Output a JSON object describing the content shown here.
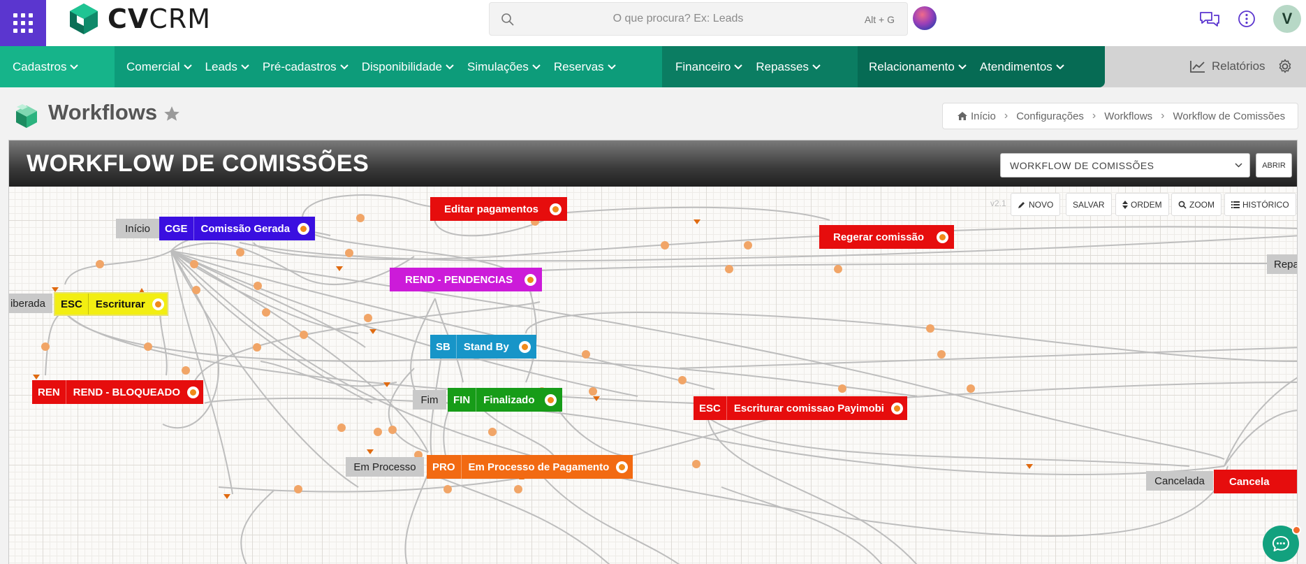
{
  "app": {
    "logo_text_bold": "CV",
    "logo_text_light": "CRM",
    "search_placeholder": "O que procura? Ex: Leads",
    "search_shortcut": "Alt + G",
    "avatar_letter": "V"
  },
  "nav": {
    "items": [
      {
        "label": "Cadastros"
      },
      {
        "label": "Comercial"
      },
      {
        "label": "Leads"
      },
      {
        "label": "Pré-cadastros"
      },
      {
        "label": "Disponibilidade"
      },
      {
        "label": "Simulações"
      },
      {
        "label": "Reservas"
      },
      {
        "label": "Financeiro"
      },
      {
        "label": "Repasses"
      },
      {
        "label": "Relacionamento"
      },
      {
        "label": "Atendimentos"
      }
    ],
    "reports_label": "Relatórios"
  },
  "page": {
    "title": "Workflows",
    "breadcrumb": [
      "Início",
      "Configurações",
      "Workflows",
      "Workflow de Comissões"
    ]
  },
  "workflow": {
    "title": "WORKFLOW DE COMISSÕES",
    "selected": "WORKFLOW DE COMISSÕES",
    "open_label": "ABRIR",
    "version": "v2.1",
    "toolbar": {
      "novo": "NOVO",
      "salvar": "SALVAR",
      "ordem": "ORDEM",
      "zoom": "ZOOM",
      "historico": "HISTÓRICO"
    },
    "nodes": {
      "cge": {
        "code": "CGE",
        "label": "Comissão Gerada"
      },
      "editar": {
        "label": "Editar pagamentos"
      },
      "regerar": {
        "label": "Regerar comissão"
      },
      "pendencias": {
        "label": "REND - PENDENCIAS"
      },
      "esc": {
        "code": "ESC",
        "label": "Escriturar"
      },
      "sb": {
        "code": "SB",
        "label": "Stand By"
      },
      "ren": {
        "code": "REN",
        "label": "REND - BLOQUEADO"
      },
      "fin": {
        "code": "FIN",
        "label": "Finalizado"
      },
      "escp": {
        "code": "ESC",
        "label": "Escriturar comissao Payimobi"
      },
      "pro": {
        "code": "PRO",
        "label": "Em Processo de Pagamento"
      },
      "cancel": {
        "label": "Cancela"
      }
    },
    "labels": {
      "inicio": "Início",
      "liberada": "iberada",
      "fim": "Fim",
      "em_processo": "Em Processo",
      "cancelada": "Cancelada",
      "repas": "Repas"
    },
    "colors": {
      "cge": "#3a0fe0",
      "editar": "#e60d0d",
      "regerar": "#e60d0d",
      "pendencias": "#cc1bd9",
      "esc": "#f2ee12",
      "sb": "#1795c8",
      "ren": "#e60d0d",
      "fin": "#179c18",
      "escp": "#e60d0d",
      "pro": "#f26a12",
      "cancel": "#e60d0d"
    }
  }
}
